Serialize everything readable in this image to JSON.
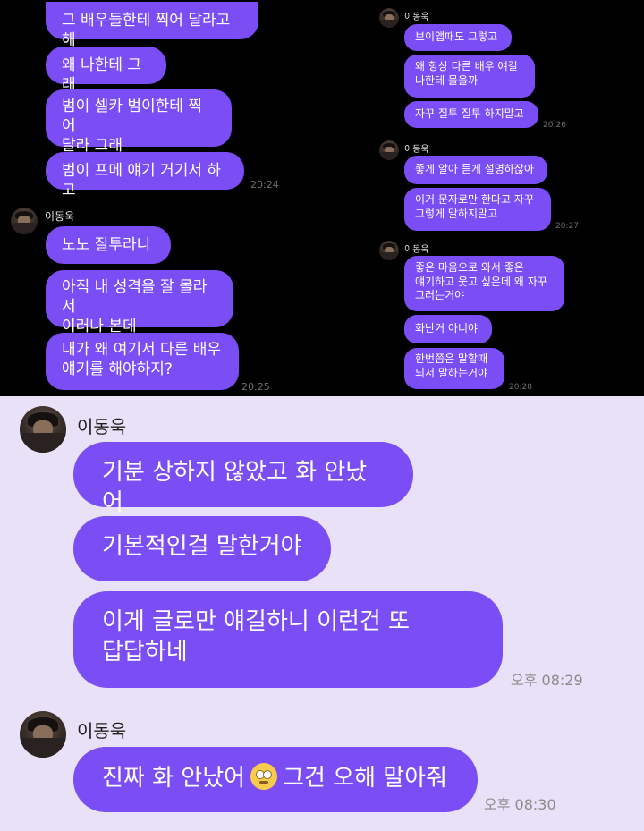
{
  "top_left": {
    "messages": [
      "그 배우들한테 찍어 달라고 해",
      "왜 나한테 그래",
      "범이 셀카 범이한테 찍어\n달라 그래",
      "범이 프메 얘기 거기서 하고"
    ],
    "time_1": "20:24",
    "sender": "이동욱",
    "messages_2": [
      "노노 질투라니",
      "아직 내 성격을 잘 몰라서\n이러나 본데",
      "내가 왜 여기서 다른 배우\n얘기를 해야하지?"
    ],
    "time_2": "20:25"
  },
  "top_right": {
    "sender_1": "이동욱",
    "group_1": [
      "브이앱때도 그렇고",
      "왜 항상 다른 배우 얘길\n나한테 물을까",
      "자꾸 질투 질투 하지말고"
    ],
    "time_1": "20:26",
    "sender_2": "이동욱",
    "group_2": [
      "좋게 알아 듣게 설명하잖아",
      "이거 문자로만 한다고 자꾸\n그렇게 말하지말고"
    ],
    "time_2": "20:27",
    "sender_3": "이동욱",
    "group_3": [
      "좋은 마음으로 와서 좋은\n얘기하고 웃고 싶은데 왜 자꾸\n그러는거야",
      "화난거 아니야",
      "한번쯤은 말할때\n되서 말하는거야"
    ],
    "time_3": "20:28"
  },
  "bottom": {
    "sender_1": "이동욱",
    "messages": [
      "기분 상하지 않았고 화 안났어",
      "기본적인걸 말한거야",
      "이게 글로만 얘길하니 이런건 또\n답답하네"
    ],
    "time_1": "오후 08:29",
    "sender_2": "이동욱",
    "last_before_emoji": "진짜 화 안났어",
    "last_emoji": "eye-roll-emoji",
    "last_after_emoji": "그건 오해 말아줘",
    "time_2": "오후 08:30"
  },
  "colors": {
    "bubble": "#7b4df4",
    "bottom_background": "#e9e1f7",
    "top_background": "#000000"
  }
}
